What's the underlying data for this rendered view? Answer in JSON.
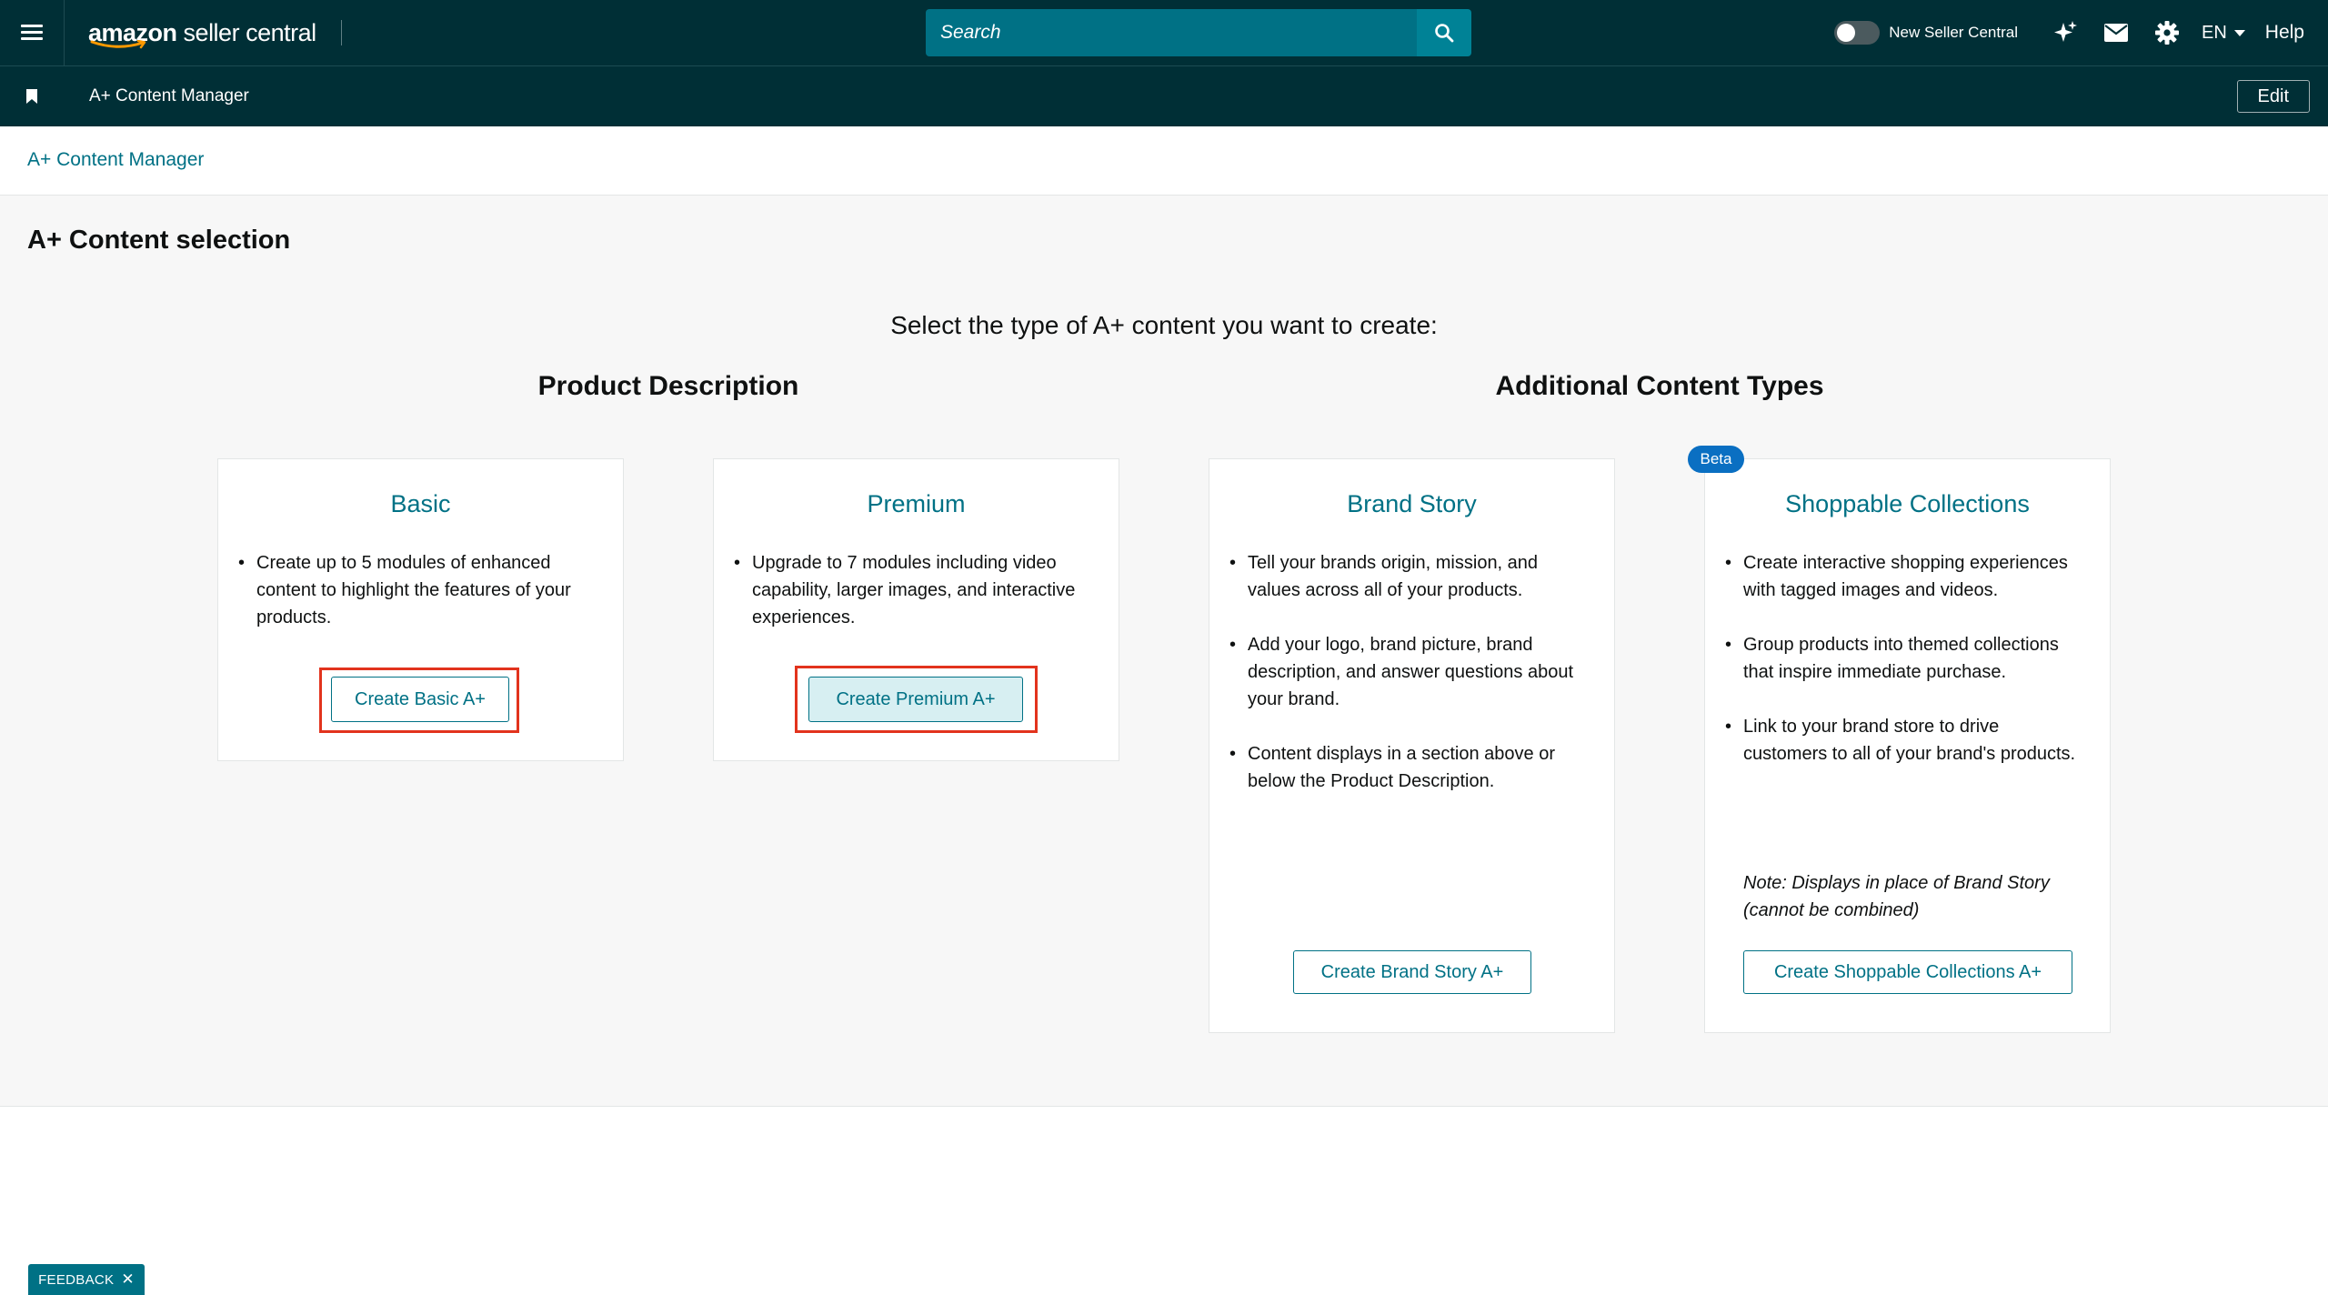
{
  "header": {
    "logo": {
      "brand": "amazon",
      "product": "seller central"
    },
    "search": {
      "placeholder": "Search"
    },
    "toggle_label": "New Seller Central",
    "language": "EN",
    "help": "Help"
  },
  "subbar": {
    "title": "A+ Content Manager",
    "edit": "Edit"
  },
  "breadcrumb": "A+ Content Manager",
  "page": {
    "title": "A+ Content selection",
    "prompt": "Select the type of A+ content you want to create:",
    "groups": {
      "product_description": "Product Description",
      "additional": "Additional Content Types"
    }
  },
  "cards": {
    "basic": {
      "title": "Basic",
      "bullets": [
        "Create up to 5 modules of enhanced content to highlight the features of your products."
      ],
      "button": "Create Basic A+"
    },
    "premium": {
      "title": "Premium",
      "bullets": [
        "Upgrade to 7 modules including video capability, larger images, and interactive experiences."
      ],
      "button": "Create Premium A+"
    },
    "brand_story": {
      "title": "Brand Story",
      "bullets": [
        "Tell your brands origin, mission, and values across all of your products.",
        "Add your logo, brand picture, brand description, and answer questions about your brand.",
        "Content displays in a section above or below the Product Description."
      ],
      "button": "Create Brand Story A+"
    },
    "shoppable": {
      "badge": "Beta",
      "title": "Shoppable Collections",
      "bullets": [
        "Create interactive shopping experiences with tagged images and videos.",
        "Group products into themed collections that inspire immediate purchase.",
        "Link to your brand store to drive customers to all of your brand's products."
      ],
      "note": "Note: Displays in place of Brand Story (cannot be combined)",
      "button": "Create Shoppable Collections A+"
    }
  },
  "feedback": {
    "label": "FEEDBACK",
    "close": "✕"
  },
  "colors": {
    "header_bg": "#002f36",
    "accent": "#007185",
    "highlight": "#e2331d",
    "beta_badge": "#0a6fc2"
  }
}
